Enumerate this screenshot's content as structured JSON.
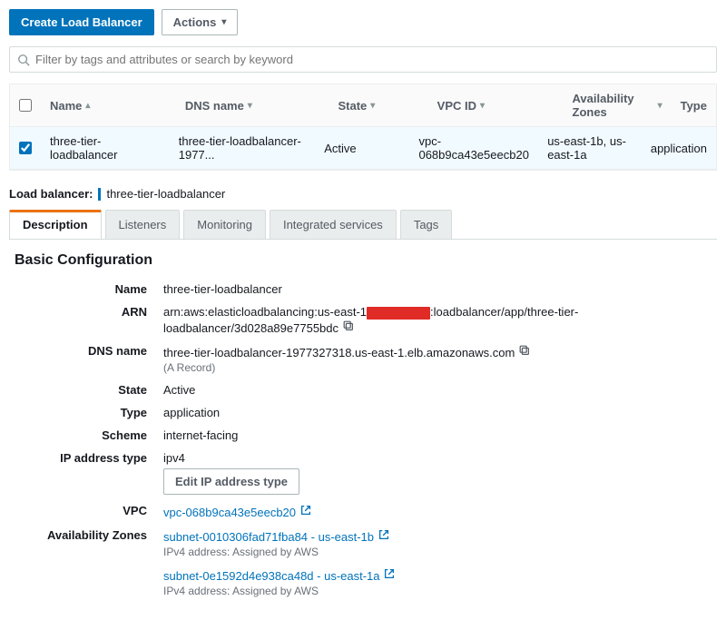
{
  "toolbar": {
    "create_label": "Create Load Balancer",
    "actions_label": "Actions"
  },
  "filter": {
    "placeholder": "Filter by tags and attributes or search by keyword"
  },
  "columns": {
    "name": "Name",
    "dns": "DNS name",
    "state": "State",
    "vpc": "VPC ID",
    "az": "Availability Zones",
    "type": "Type"
  },
  "row": {
    "name": "three-tier-loadbalancer",
    "dns": "three-tier-loadbalancer-1977...",
    "state": "Active",
    "vpc": "vpc-068b9ca43e5eecb20",
    "az": "us-east-1b, us-east-1a",
    "type": "application"
  },
  "selected": {
    "label": "Load balancer:",
    "value": "three-tier-loadbalancer"
  },
  "tabs": {
    "description": "Description",
    "listeners": "Listeners",
    "monitoring": "Monitoring",
    "integrated": "Integrated services",
    "tags": "Tags"
  },
  "section_title": "Basic Configuration",
  "details": {
    "name_label": "Name",
    "name_value": "three-tier-loadbalancer",
    "arn_label": "ARN",
    "arn_prefix": "arn:aws:elasticloadbalancing:us-east-1",
    "arn_suffix": ":loadbalancer/app/three-tier-loadbalancer/3d028a89e7755bdc",
    "dns_label": "DNS name",
    "dns_value": "three-tier-loadbalancer-1977327318.us-east-1.elb.amazonaws.com",
    "dns_sub": "(A Record)",
    "state_label": "State",
    "state_value": "Active",
    "type_label": "Type",
    "type_value": "application",
    "scheme_label": "Scheme",
    "scheme_value": "internet-facing",
    "ip_label": "IP address type",
    "ip_value": "ipv4",
    "edit_ip_label": "Edit IP address type",
    "vpc_label": "VPC",
    "vpc_value": "vpc-068b9ca43e5eecb20",
    "az_label": "Availability Zones",
    "az1_link": "subnet-0010306fad71fba84 - us-east-1b",
    "az1_sub": "IPv4 address: Assigned by AWS",
    "az2_link": "subnet-0e1592d4e938ca48d - us-east-1a",
    "az2_sub": "IPv4 address: Assigned by AWS"
  }
}
